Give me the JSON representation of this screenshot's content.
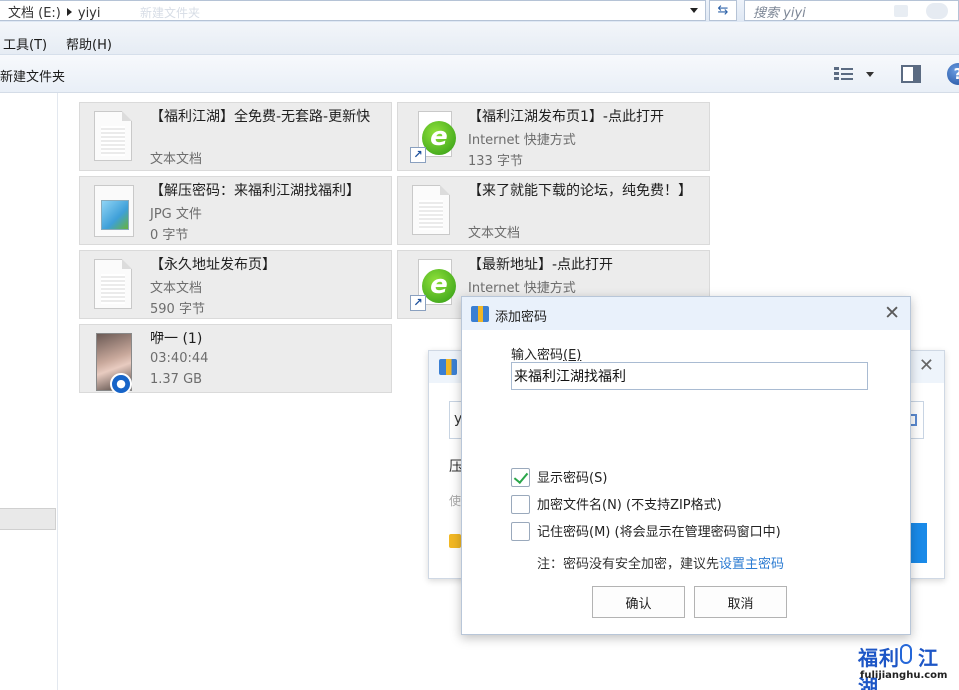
{
  "address_bar": {
    "path_drive": "文档 (E:)",
    "path_folder": "yiyi",
    "faded_text": "新建文件夹",
    "search_placeholder": "搜索 yiyi"
  },
  "menu": [
    {
      "label": "工具(T)"
    },
    {
      "label": "帮助(H)"
    }
  ],
  "toolbar": {
    "new_folder_label": "新建文件夹"
  },
  "files": [
    {
      "name": "【福利江湖】全免费-无套路-更新快",
      "line1": "文本文档",
      "line2": "",
      "icon": "text-doc-icon"
    },
    {
      "name": "【福利江湖发布页1】-点此打开",
      "line1": "Internet 快捷方式",
      "line2": "133 字节",
      "icon": "ie-shortcut-icon"
    },
    {
      "name": "【解压密码：来福利江湖找福利】",
      "line1": "JPG 文件",
      "line2": "0 字节",
      "icon": "jpg-file-icon"
    },
    {
      "name": "【来了就能下载的论坛，纯免费！】",
      "line1": "文本文档",
      "line2": "",
      "icon": "text-doc-icon"
    },
    {
      "name": "【永久地址发布页】",
      "line1": "文本文档",
      "line2": "590 字节",
      "icon": "text-doc-icon"
    },
    {
      "name": "【最新地址】-点此打开",
      "line1": "Internet 快捷方式",
      "line2": "",
      "icon": "ie-shortcut-icon"
    },
    {
      "name": "咿一 (1)",
      "line1": "03:40:44",
      "line2": "1.37 GB",
      "icon": "video-thumbnail-icon"
    }
  ],
  "background_dialog": {
    "input_prefix": "y",
    "label1": "压",
    "label2": "使"
  },
  "dialog": {
    "title": "添加密码",
    "password_label": "输入密码",
    "password_label_key": "(E)",
    "password_value": "来福利江湖找福利",
    "options": [
      {
        "label": "显示密码(S)",
        "checked": true
      },
      {
        "label": "加密文件名(N) (不支持ZIP格式)",
        "checked": false
      },
      {
        "label": "记住密码(M) (将会显示在管理密码窗口中)",
        "checked": false
      }
    ],
    "note_text": "注：密码没有安全加密，建议先",
    "note_link": "设置主密码",
    "ok_label": "确认",
    "cancel_label": "取消"
  },
  "watermark": {
    "text_left": "福利",
    "text_right": "江湖",
    "url": "fulijianghu.com"
  },
  "colors": {
    "link": "#2b7bd2",
    "check": "#2aa64a",
    "watermark": "#1d56c6"
  }
}
